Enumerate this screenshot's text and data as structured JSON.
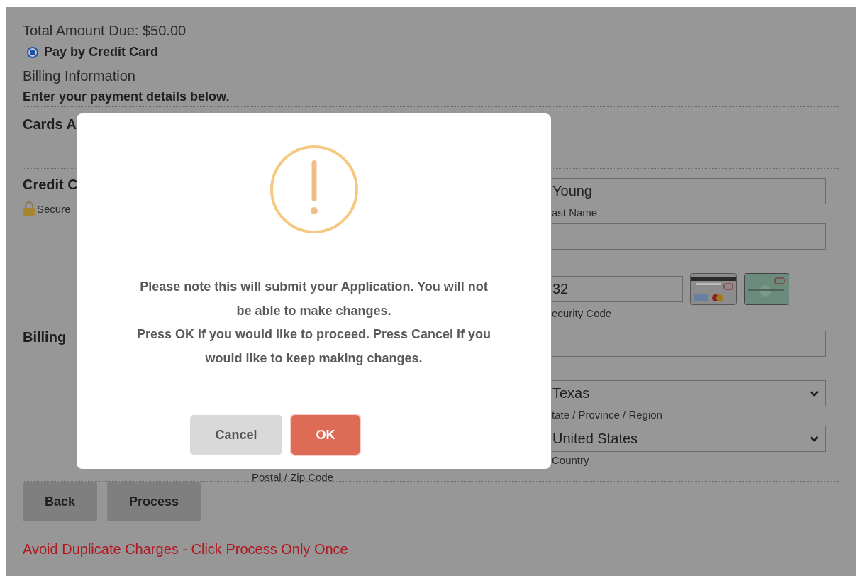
{
  "payment": {
    "total": "Total Amount Due: $50.00",
    "option": {
      "label": "Pay by Credit Card",
      "selected": true
    },
    "heading": "Billing Information",
    "instructions": "Enter your payment details below.",
    "sections": [
      {
        "heading": "Cards A"
      },
      {
        "heading": "Credit C",
        "note": "Secure",
        "rows": [
          {
            "kind": "text",
            "value": "Young",
            "label": "ast Name"
          },
          {
            "kind": "text"
          },
          {
            "kind": "cvv",
            "value": "32",
            "label": "ecurity Code"
          }
        ]
      },
      {
        "heading": "Billing",
        "rows": [
          {
            "kind": "text"
          },
          {
            "kind": "select",
            "value": "Texas",
            "label": "tate / Province / Region"
          },
          {
            "kind": "select",
            "value": "United States",
            "label": "Country",
            "side_label": "Postal / Zip Code"
          }
        ]
      }
    ],
    "buttons": [
      "Back",
      "Process"
    ],
    "warning": "Avoid Duplicate Charges - Click Process Only Once"
  },
  "dialog": {
    "message": [
      "Please note this will submit your Application. You will not be able to make changes.",
      "Press OK if you would like to proceed. Press Cancel if you would like to keep making changes."
    ],
    "buttons": [
      {
        "label": "Cancel",
        "kind": "cancel"
      },
      {
        "label": "OK",
        "kind": "confirm"
      }
    ]
  }
}
